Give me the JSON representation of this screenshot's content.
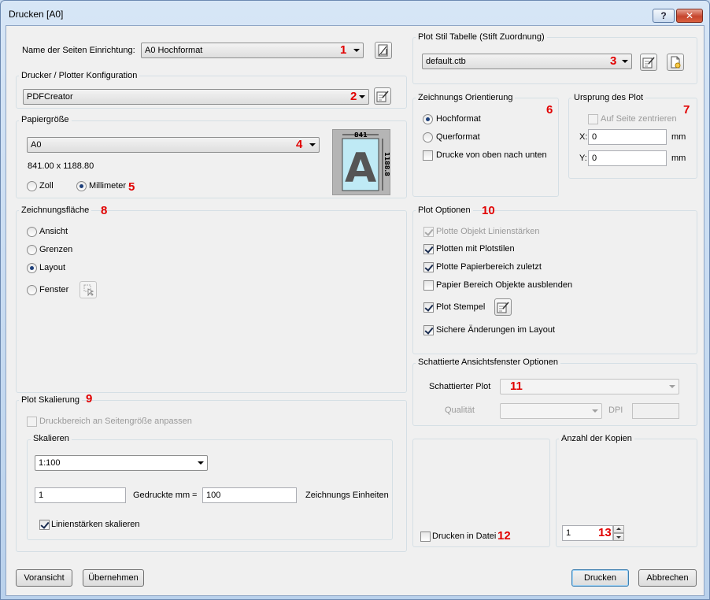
{
  "window": {
    "title": "Drucken [A0]",
    "help_label": "?",
    "close_label": "✕"
  },
  "page_setup": {
    "label": "Name der Seiten Einrichtung:",
    "value": "A0 Hochformat",
    "marker": "1"
  },
  "printer": {
    "title": "Drucker / Plotter Konfiguration",
    "value": "PDFCreator",
    "marker": "2"
  },
  "paper": {
    "title": "Papiergröße",
    "value": "A0",
    "marker": "4",
    "size_text": "841.00 x 1188.80",
    "units": [
      {
        "label": "Zoll",
        "selected": false
      },
      {
        "label": "Millimeter",
        "selected": true
      }
    ],
    "units_marker": "5",
    "preview": {
      "width_label": "841",
      "height_label": "1188.8",
      "letter": "A"
    }
  },
  "plot_area": {
    "title": "Zeichnungsfläche",
    "marker": "8",
    "options": [
      {
        "label": "Ansicht",
        "selected": false
      },
      {
        "label": "Grenzen",
        "selected": false
      },
      {
        "label": "Layout",
        "selected": true
      },
      {
        "label": "Fenster",
        "selected": false
      }
    ]
  },
  "plot_scale": {
    "title": "Plot Skalierung",
    "marker": "9",
    "fit_label": "Druckbereich an Seitengröße anpassen",
    "fit_checked": false,
    "scale_group_title": "Skalieren",
    "scale_value": "1:100",
    "printed_value": "1",
    "printed_label": "Gedruckte mm",
    "equals": "=",
    "units_value": "100",
    "units_label": "Zeichnungs Einheiten",
    "lineweights_label": "Linienstärken skalieren",
    "lineweights_checked": true
  },
  "plot_style": {
    "title": "Plot Stil Tabelle (Stift Zuordnung)",
    "value": "default.ctb",
    "marker": "3"
  },
  "orientation": {
    "title": "Zeichnungs Orientierung",
    "marker": "6",
    "options": [
      {
        "label": "Hochformat",
        "selected": true
      },
      {
        "label": "Querformat",
        "selected": false
      }
    ],
    "upside_down_label": "Drucke von oben nach unten",
    "upside_down_checked": false
  },
  "offset": {
    "title": "Ursprung des Plot",
    "marker": "7",
    "center_label": "Auf Seite zentrieren",
    "center_checked": false,
    "x_label": "X:",
    "x_value": "0",
    "y_label": "Y:",
    "y_value": "0",
    "unit": "mm"
  },
  "plot_options": {
    "title": "Plot Optionen",
    "marker": "10",
    "items": [
      {
        "label": "Plotte Objekt Linienstärken",
        "checked": true,
        "disabled": true
      },
      {
        "label": "Plotten mit Plotstilen",
        "checked": true,
        "disabled": false
      },
      {
        "label": "Plotte Papierbereich zuletzt",
        "checked": true,
        "disabled": false
      },
      {
        "label": "Papier Bereich Objekte ausblenden",
        "checked": false,
        "disabled": false
      },
      {
        "label": "Plot Stempel",
        "checked": true,
        "disabled": false
      },
      {
        "label": "Sichere Änderungen im Layout",
        "checked": true,
        "disabled": false
      }
    ]
  },
  "shaded": {
    "title": "Schattierte Ansichtsfenster Optionen",
    "plot_label": "Schattierter Plot",
    "marker": "11",
    "quality_label": "Qualität",
    "dpi_label": "DPI"
  },
  "print_file": {
    "label": "Drucken in Datei",
    "checked": false,
    "marker": "12"
  },
  "copies": {
    "title": "Anzahl der Kopien",
    "value": "1",
    "marker": "13"
  },
  "buttons": {
    "preview": "Voransicht",
    "apply": "Übernehmen",
    "print": "Drucken",
    "cancel": "Abbrechen"
  }
}
